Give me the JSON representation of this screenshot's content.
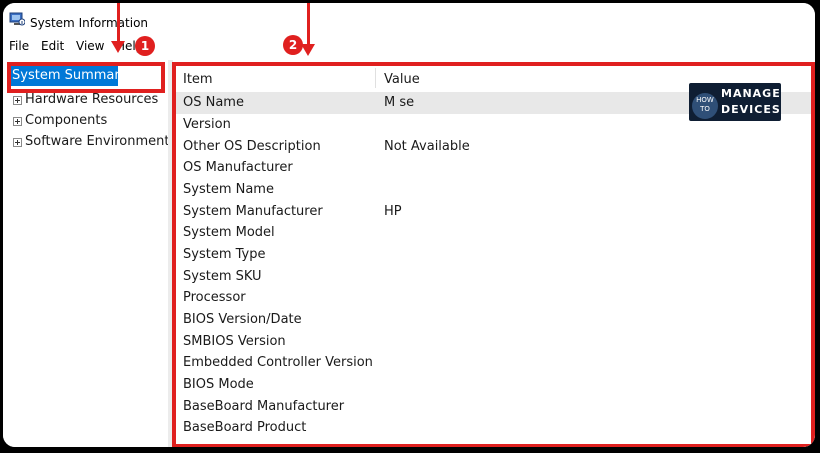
{
  "window": {
    "title": "System Information",
    "icon": "system-info-icon"
  },
  "menu": {
    "file": "File",
    "edit": "Edit",
    "view": "View",
    "help": "Help"
  },
  "tree": {
    "selected": "System Summary",
    "items": [
      "Hardware Resources",
      "Components",
      "Software Environment"
    ]
  },
  "list": {
    "headers": {
      "item": "Item",
      "value": "Value"
    },
    "rows": [
      {
        "item": "OS Name",
        "value": "M                                    se"
      },
      {
        "item": "Version",
        "value": ""
      },
      {
        "item": "Other OS Description",
        "value": "Not Available"
      },
      {
        "item": "OS Manufacturer",
        "value": ""
      },
      {
        "item": "System Name",
        "value": ""
      },
      {
        "item": "System Manufacturer",
        "value": "HP"
      },
      {
        "item": "System Model",
        "value": ""
      },
      {
        "item": "System Type",
        "value": ""
      },
      {
        "item": "System SKU",
        "value": ""
      },
      {
        "item": "Processor",
        "value": ""
      },
      {
        "item": "BIOS Version/Date",
        "value": ""
      },
      {
        "item": "SMBIOS Version",
        "value": ""
      },
      {
        "item": "Embedded Controller Version",
        "value": ""
      },
      {
        "item": "BIOS Mode",
        "value": ""
      },
      {
        "item": "BaseBoard Manufacturer",
        "value": ""
      },
      {
        "item": "BaseBoard Product",
        "value": ""
      }
    ]
  },
  "annotations": {
    "badge1": "1",
    "badge2": "2",
    "color": "#e0201f"
  },
  "logo": {
    "how": "HOW TO",
    "line1": "MANAGE",
    "line2": "DEVICES"
  },
  "colors": {
    "selection": "#0078d7",
    "highlight_row": "#e8e8e8"
  }
}
